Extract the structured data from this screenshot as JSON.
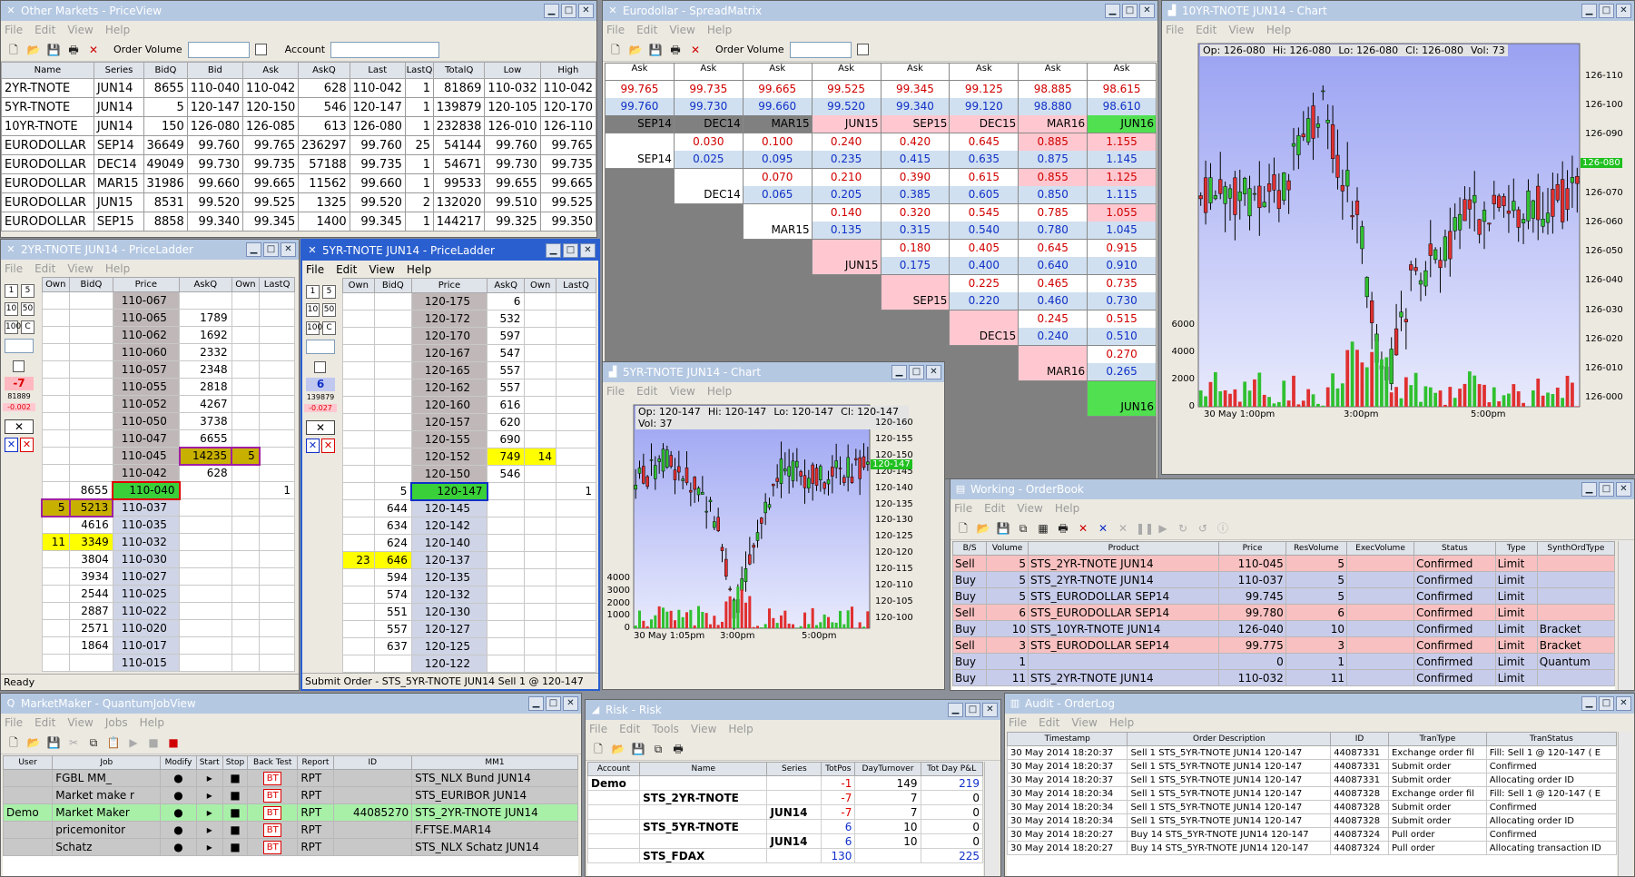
{
  "priceview": {
    "title": "Other Markets - PriceView",
    "menu": [
      "File",
      "Edit",
      "View",
      "Help"
    ],
    "order_volume_label": "Order Volume",
    "account_label": "Account",
    "columns": [
      "Name",
      "Series",
      "BidQ",
      "Bid",
      "Ask",
      "AskQ",
      "Last",
      "LastQ",
      "TotalQ",
      "Low",
      "High"
    ],
    "rows": [
      [
        "2YR-TNOTE",
        "JUN14",
        "8655",
        "110-040",
        "110-042",
        "628",
        "110-042",
        "1",
        "81869",
        "110-032",
        "110-042"
      ],
      [
        "5YR-TNOTE",
        "JUN14",
        "5",
        "120-147",
        "120-150",
        "546",
        "120-147",
        "1",
        "139879",
        "120-105",
        "120-170"
      ],
      [
        "10YR-TNOTE",
        "JUN14",
        "150",
        "126-080",
        "126-085",
        "613",
        "126-080",
        "1",
        "232838",
        "126-010",
        "126-110"
      ],
      [
        "EURODOLLAR",
        "SEP14",
        "36649",
        "99.760",
        "99.765",
        "236297",
        "99.760",
        "25",
        "54144",
        "99.760",
        "99.765"
      ],
      [
        "EURODOLLAR",
        "DEC14",
        "49049",
        "99.730",
        "99.735",
        "57188",
        "99.735",
        "1",
        "54671",
        "99.730",
        "99.735"
      ],
      [
        "EURODOLLAR",
        "MAR15",
        "31986",
        "99.660",
        "99.665",
        "11562",
        "99.660",
        "1",
        "99533",
        "99.655",
        "99.665"
      ],
      [
        "EURODOLLAR",
        "JUN15",
        "8531",
        "99.520",
        "99.525",
        "1325",
        "99.520",
        "2",
        "132020",
        "99.510",
        "99.525"
      ],
      [
        "EURODOLLAR",
        "SEP15",
        "8858",
        "99.340",
        "99.345",
        "1400",
        "99.345",
        "1",
        "144217",
        "99.325",
        "99.350"
      ]
    ]
  },
  "ladder2": {
    "title": "2YR-TNOTE JUN14 - PriceLadder",
    "menu": [
      "File",
      "Edit",
      "View",
      "Help"
    ],
    "columns": [
      "Own",
      "BidQ",
      "Price",
      "AskQ",
      "Own",
      "LastQ"
    ],
    "keys": [
      "1",
      "5",
      "10",
      "50",
      "100",
      "C"
    ],
    "pos": "-7",
    "vol": "81889",
    "chg": "-0.002",
    "rows": [
      [
        "",
        "",
        "110-067",
        "",
        "",
        ""
      ],
      [
        "",
        "",
        "110-065",
        "1789",
        "",
        ""
      ],
      [
        "",
        "",
        "110-062",
        "1692",
        "",
        ""
      ],
      [
        "",
        "",
        "110-060",
        "2332",
        "",
        ""
      ],
      [
        "",
        "",
        "110-057",
        "2348",
        "",
        ""
      ],
      [
        "",
        "",
        "110-055",
        "2818",
        "",
        ""
      ],
      [
        "",
        "",
        "110-052",
        "4267",
        "",
        ""
      ],
      [
        "",
        "",
        "110-050",
        "3738",
        "",
        ""
      ],
      [
        "",
        "",
        "110-047",
        "6655",
        "",
        ""
      ],
      [
        "",
        "",
        "110-045",
        "14235",
        "5",
        ""
      ],
      [
        "",
        "",
        "110-042",
        "628",
        "",
        ""
      ],
      [
        "",
        "8655",
        "110-040",
        "",
        "",
        "1"
      ],
      [
        "5",
        "5213",
        "110-037",
        "",
        "",
        ""
      ],
      [
        "",
        "4616",
        "110-035",
        "",
        "",
        ""
      ],
      [
        "11",
        "3349",
        "110-032",
        "",
        "",
        ""
      ],
      [
        "",
        "3804",
        "110-030",
        "",
        "",
        ""
      ],
      [
        "",
        "3934",
        "110-027",
        "",
        "",
        ""
      ],
      [
        "",
        "2544",
        "110-025",
        "",
        "",
        ""
      ],
      [
        "",
        "2887",
        "110-022",
        "",
        "",
        ""
      ],
      [
        "",
        "2571",
        "110-020",
        "",
        "",
        ""
      ],
      [
        "",
        "1864",
        "110-017",
        "",
        "",
        ""
      ],
      [
        "",
        "",
        "110-015",
        "",
        "",
        ""
      ]
    ],
    "status": "Ready"
  },
  "ladder5": {
    "title": "5YR-TNOTE JUN14 - PriceLadder",
    "menu": [
      "File",
      "Edit",
      "View",
      "Help"
    ],
    "columns": [
      "Own",
      "BidQ",
      "Price",
      "AskQ",
      "Own",
      "LastQ"
    ],
    "keys": [
      "1",
      "5",
      "10",
      "50",
      "100",
      "C"
    ],
    "pos": "6",
    "vol": "139879",
    "chg": "-0.027",
    "rows": [
      [
        "",
        "",
        "120-175",
        "6",
        "",
        ""
      ],
      [
        "",
        "",
        "120-172",
        "532",
        "",
        ""
      ],
      [
        "",
        "",
        "120-170",
        "597",
        "",
        ""
      ],
      [
        "",
        "",
        "120-167",
        "547",
        "",
        ""
      ],
      [
        "",
        "",
        "120-165",
        "557",
        "",
        ""
      ],
      [
        "",
        "",
        "120-162",
        "557",
        "",
        ""
      ],
      [
        "",
        "",
        "120-160",
        "616",
        "",
        ""
      ],
      [
        "",
        "",
        "120-157",
        "620",
        "",
        ""
      ],
      [
        "",
        "",
        "120-155",
        "690",
        "",
        ""
      ],
      [
        "",
        "",
        "120-152",
        "749",
        "14",
        ""
      ],
      [
        "",
        "",
        "120-150",
        "546",
        "",
        ""
      ],
      [
        "",
        "5",
        "120-147",
        "",
        "",
        "1"
      ],
      [
        "",
        "644",
        "120-145",
        "",
        "",
        ""
      ],
      [
        "",
        "634",
        "120-142",
        "",
        "",
        ""
      ],
      [
        "",
        "624",
        "120-140",
        "",
        "",
        ""
      ],
      [
        "23",
        "646",
        "120-137",
        "",
        "",
        ""
      ],
      [
        "",
        "594",
        "120-135",
        "",
        "",
        ""
      ],
      [
        "",
        "574",
        "120-132",
        "",
        "",
        ""
      ],
      [
        "",
        "551",
        "120-130",
        "",
        "",
        ""
      ],
      [
        "",
        "557",
        "120-127",
        "",
        "",
        ""
      ],
      [
        "",
        "637",
        "120-125",
        "",
        "",
        ""
      ],
      [
        "",
        "",
        "120-122",
        "",
        "",
        ""
      ]
    ],
    "status": "Submit Order - STS_5YR-TNOTE JUN14  Sell  1 @ 120-147"
  },
  "spread": {
    "title": "Eurodollar - SpreadMatrix",
    "menu": [
      "File",
      "Edit",
      "View",
      "Help"
    ],
    "order_volume_label": "Order Volume",
    "ask_label": "Ask",
    "top_ask": [
      "99.765",
      "99.735",
      "99.665",
      "99.525",
      "99.345",
      "99.125",
      "98.885",
      "98.615"
    ],
    "top_bid": [
      "99.760",
      "99.730",
      "99.660",
      "99.520",
      "99.340",
      "99.120",
      "98.880",
      "98.610"
    ],
    "months": [
      "SEP14",
      "DEC14",
      "MAR15",
      "JUN15",
      "SEP15",
      "DEC15",
      "MAR16",
      "JUN16"
    ],
    "cells": [
      [
        [
          "0.030",
          "0.025"
        ],
        [
          "0.100",
          "0.095"
        ],
        [
          "0.240",
          "0.235"
        ],
        [
          "0.420",
          "0.415"
        ],
        [
          "0.645",
          "0.635"
        ],
        [
          "0.885",
          "0.875"
        ],
        [
          "1.155",
          "1.145"
        ]
      ],
      [
        [
          "0.070",
          "0.065"
        ],
        [
          "0.210",
          "0.205"
        ],
        [
          "0.390",
          "0.385"
        ],
        [
          "0.615",
          "0.605"
        ],
        [
          "0.855",
          "0.850"
        ],
        [
          "1.125",
          "1.115"
        ]
      ],
      [
        [
          "0.140",
          "0.135"
        ],
        [
          "0.320",
          "0.315"
        ],
        [
          "0.545",
          "0.540"
        ],
        [
          "0.785",
          "0.780"
        ],
        [
          "1.055",
          "1.045"
        ]
      ],
      [
        [
          "0.180",
          "0.175"
        ],
        [
          "0.405",
          "0.400"
        ],
        [
          "0.645",
          "0.640"
        ],
        [
          "0.915",
          "0.910"
        ]
      ],
      [
        [
          "0.225",
          "0.220"
        ],
        [
          "0.465",
          "0.460"
        ],
        [
          "0.735",
          "0.730"
        ]
      ],
      [
        [
          "0.245",
          "0.240"
        ],
        [
          "0.515",
          "0.510"
        ]
      ],
      [
        [
          "0.270",
          "0.265"
        ]
      ]
    ]
  },
  "chart10": {
    "title": "10YR-TNOTE JUN14 - Chart",
    "menu": [
      "File",
      "Edit",
      "View",
      "Help"
    ],
    "legend_op": "Op: 126-080",
    "legend_hi": "Hi: 126-080",
    "legend_lo": "Lo: 126-080",
    "legend_cl": "Cl: 126-080",
    "legend_vol": "Vol: 73",
    "last_tag": "126-080",
    "chart_data": {
      "type": "candlestick",
      "title": "",
      "y_ticks": [
        "126-110",
        "126-100",
        "126-090",
        "126-080",
        "126-070",
        "126-060",
        "126-050",
        "126-040",
        "126-030",
        "126-020",
        "126-010",
        "126-000"
      ],
      "vol_ticks": [
        "6000",
        "4000",
        "2000",
        "0"
      ],
      "x_ticks": [
        "30 May 1:00pm",
        "3:00pm",
        "5:00pm"
      ],
      "ylim": [
        126.0,
        126.11
      ]
    }
  },
  "chart5": {
    "title": "5YR-TNOTE JUN14 - Chart",
    "menu": [
      "File",
      "Edit",
      "View",
      "Help"
    ],
    "legend_op": "Op: 120-147",
    "legend_hi": "Hi: 120-147",
    "legend_lo": "Lo: 120-147",
    "legend_cl": "Cl: 120-147",
    "legend_vol": "Vol: 37",
    "last_tag": "120-147",
    "chart_data": {
      "type": "candlestick",
      "title": "",
      "y_ticks": [
        "120-160",
        "120-155",
        "120-150",
        "120-145",
        "120-140",
        "120-135",
        "120-130",
        "120-125",
        "120-120",
        "120-115",
        "120-110",
        "120-105",
        "120-100"
      ],
      "vol_ticks": [
        "4000",
        "3000",
        "2000",
        "1000",
        "0"
      ],
      "x_ticks": [
        "30 May 1:05pm",
        "3:00pm",
        "5:00pm"
      ],
      "ylim": [
        120.1,
        120.16
      ]
    }
  },
  "orderbook": {
    "title": "Working - OrderBook",
    "menu": [
      "File",
      "Edit",
      "View",
      "Help"
    ],
    "columns": [
      "B/S",
      "Volume",
      "Product",
      "Price",
      "ResVolume",
      "ExecVolume",
      "Status",
      "Type",
      "SynthOrdType"
    ],
    "rows": [
      [
        "Sell",
        "5",
        "STS_2YR-TNOTE JUN14",
        "110-045",
        "5",
        "",
        "Confirmed",
        "Limit",
        ""
      ],
      [
        "Buy",
        "5",
        "STS_2YR-TNOTE JUN14",
        "110-037",
        "5",
        "",
        "Confirmed",
        "Limit",
        ""
      ],
      [
        "Buy",
        "5",
        "STS_EURODOLLAR SEP14",
        "99.745",
        "5",
        "",
        "Confirmed",
        "Limit",
        ""
      ],
      [
        "Sell",
        "6",
        "STS_EURODOLLAR SEP14",
        "99.780",
        "6",
        "",
        "Confirmed",
        "Limit",
        ""
      ],
      [
        "Buy",
        "10",
        "STS_10YR-TNOTE JUN14",
        "126-040",
        "10",
        "",
        "Confirmed",
        "Limit",
        "Bracket"
      ],
      [
        "Sell",
        "3",
        "STS_EURODOLLAR SEP14",
        "99.775",
        "3",
        "",
        "Confirmed",
        "Limit",
        "Bracket"
      ],
      [
        "Buy",
        "1",
        "",
        "0",
        "1",
        "",
        "Confirmed",
        "Limit",
        "Quantum"
      ],
      [
        "Buy",
        "11",
        "STS_2YR-TNOTE JUN14",
        "110-032",
        "11",
        "",
        "Confirmed",
        "Limit",
        ""
      ]
    ]
  },
  "jobview": {
    "title": "MarketMaker - QuantumJobView",
    "menu": [
      "File",
      "Edit",
      "View",
      "Jobs",
      "Help"
    ],
    "columns": [
      "User",
      "Job",
      "Modify",
      "Start",
      "Stop",
      "Back Test",
      "Report",
      "ID",
      "MM1"
    ],
    "rows": [
      [
        "",
        "FGBL MM_",
        "●",
        "▸",
        "■",
        "BT",
        "RPT",
        "",
        "STS_NLX Bund JUN14"
      ],
      [
        "",
        "Market make r",
        "●",
        "▸",
        "■",
        "BT",
        "RPT",
        "",
        "STS_EURIBOR JUN14"
      ],
      [
        "Demo",
        "Market Maker",
        "●",
        "▸",
        "■",
        "BT",
        "RPT",
        "44085270",
        "STS_2YR-TNOTE JUN14"
      ],
      [
        "",
        "pricemonitor",
        "●",
        "▸",
        "■",
        "BT",
        "RPT",
        "",
        "F.FTSE.MAR14"
      ],
      [
        "",
        "Schatz",
        "●",
        "▸",
        "■",
        "BT",
        "RPT",
        "",
        "STS_NLX Schatz JUN14"
      ]
    ]
  },
  "risk": {
    "title": "Risk - Risk",
    "menu": [
      "File",
      "Edit",
      "Tools",
      "View",
      "Help"
    ],
    "columns": [
      "Account",
      "Name",
      "Series",
      "TotPos",
      "DayTurnover",
      "Tot Day P&L"
    ],
    "rows": [
      [
        "Demo",
        "",
        "",
        "-1",
        "149",
        "219"
      ],
      [
        "",
        "STS_2YR-TNOTE",
        "",
        "-7",
        "7",
        "0"
      ],
      [
        "",
        "",
        "JUN14",
        "-7",
        "7",
        "0"
      ],
      [
        "",
        "STS_5YR-TNOTE",
        "",
        "6",
        "10",
        "0"
      ],
      [
        "",
        "",
        "JUN14",
        "6",
        "10",
        "0"
      ],
      [
        "",
        "STS_FDAX",
        "",
        "130",
        "",
        "225"
      ]
    ]
  },
  "audit": {
    "title": "Audit - OrderLog",
    "menu": [
      "File",
      "Edit",
      "View",
      "Help"
    ],
    "columns": [
      "Timestamp",
      "Order Description",
      "ID",
      "TranType",
      "TranStatus"
    ],
    "rows": [
      [
        "30 May 2014 18:20:37",
        "Sell 1 STS_5YR-TNOTE JUN14 120-147",
        "44087331",
        "Exchange order fil",
        "Fill: Sell 1 @ 120-147  ( E"
      ],
      [
        "30 May 2014 18:20:37",
        "Sell 1 STS_5YR-TNOTE JUN14 120-147",
        "44087331",
        "Submit order",
        "Confirmed"
      ],
      [
        "30 May 2014 18:20:37",
        "Sell 1 STS_5YR-TNOTE JUN14 120-147",
        "44087331",
        "Submit order",
        "Allocating order ID"
      ],
      [
        "30 May 2014 18:20:34",
        "Sell 1 STS_5YR-TNOTE JUN14 120-147",
        "44087328",
        "Exchange order fil",
        "Fill: Sell 1 @ 120-147  ( E"
      ],
      [
        "30 May 2014 18:20:34",
        "Sell 1 STS_5YR-TNOTE JUN14 120-147",
        "44087328",
        "Submit order",
        "Confirmed"
      ],
      [
        "30 May 2014 18:20:34",
        "Sell 1 STS_5YR-TNOTE JUN14 120-147",
        "44087328",
        "Submit order",
        "Allocating order ID"
      ],
      [
        "30 May 2014 18:20:27",
        "Buy 14 STS_5YR-TNOTE JUN14 120-147",
        "44087324",
        "Pull order",
        "Confirmed"
      ],
      [
        "30 May 2014 18:20:27",
        "Buy 14 STS_5YR-TNOTE JUN14 120-147",
        "44087324",
        "Pull order",
        "Allocating transaction ID"
      ]
    ]
  }
}
